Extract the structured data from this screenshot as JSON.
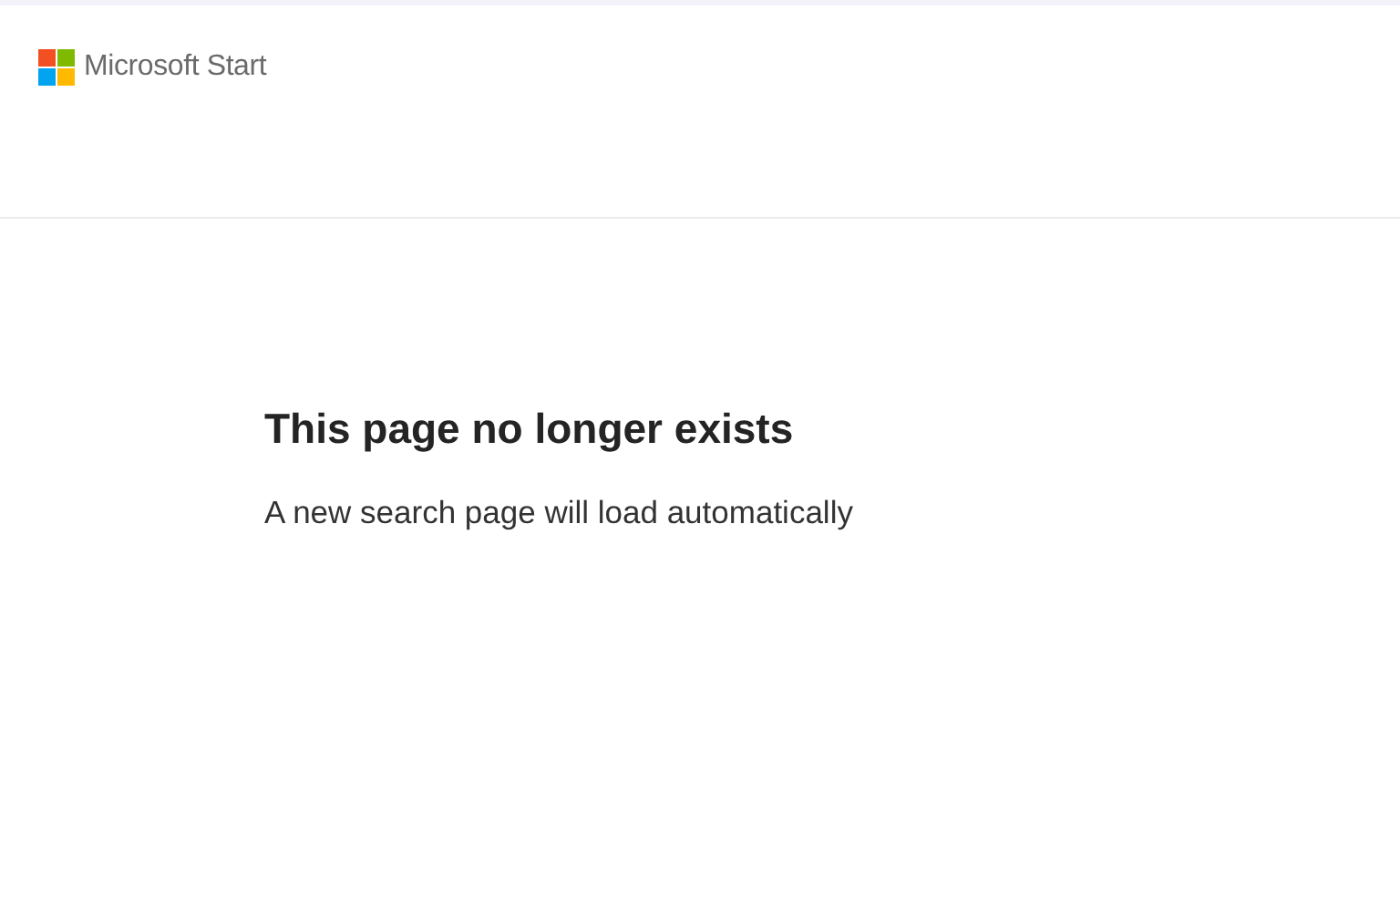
{
  "header": {
    "brand": "Microsoft Start"
  },
  "message": {
    "title": "This page no longer exists",
    "subtitle": "A new search page will load automatically"
  }
}
